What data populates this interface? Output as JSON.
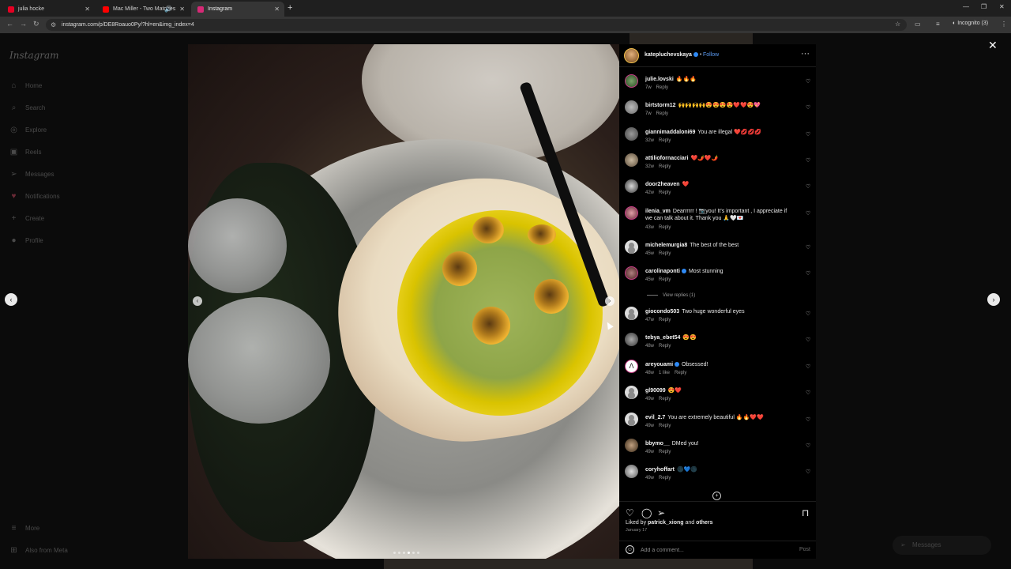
{
  "browser": {
    "tabs": [
      {
        "title": "julia hocke",
        "color": "#e60023"
      },
      {
        "title": "Mac Miller - Two Matches",
        "color": "#ff0000"
      },
      {
        "title": "Instagram",
        "color": "#d62976"
      }
    ],
    "url": "instagram.com/p/DE8Roauo0Py/?hl=en&img_index=4",
    "incognito_label": "Incognito (3)"
  },
  "sidebar": {
    "logo": "Instagram",
    "items": [
      {
        "label": "Home",
        "icon": "home-icon",
        "glyph": "⌂"
      },
      {
        "label": "Search",
        "icon": "search-icon",
        "glyph": "⌕"
      },
      {
        "label": "Explore",
        "icon": "compass-icon",
        "glyph": "◎"
      },
      {
        "label": "Reels",
        "icon": "reels-icon",
        "glyph": "▣"
      },
      {
        "label": "Messages",
        "icon": "send-icon",
        "glyph": "➢"
      },
      {
        "label": "Notifications",
        "icon": "heart-icon",
        "glyph": "♡"
      },
      {
        "label": "Create",
        "icon": "plus-icon",
        "glyph": "+"
      },
      {
        "label": "Profile",
        "icon": "avatar-icon",
        "glyph": "●"
      }
    ],
    "more": "More",
    "also_from_meta": "Also from Meta"
  },
  "post": {
    "username": "katepluchevskaya",
    "follow": "Follow",
    "likes_prefix": "Liked by",
    "liked_by": "patrick_xiong",
    "likes_and": "and",
    "likes_others": "others",
    "date": "January 17",
    "comment_placeholder": "Add a comment...",
    "post_label": "Post",
    "view_replies": "View replies (1)"
  },
  "comments": [
    {
      "user": "julie.lovski",
      "text": "🔥🔥🔥",
      "time": "7w",
      "reply": "Reply",
      "likes": ""
    },
    {
      "user": "birtstorm12",
      "text": "🙌🙌🙌🙌😍😍😍😍❤️❤️😍💖",
      "time": "7w",
      "reply": "Reply",
      "likes": ""
    },
    {
      "user": "giannimaddaloni69",
      "text": "You are illegal ❤️💋💋💋",
      "time": "32w",
      "reply": "Reply",
      "likes": ""
    },
    {
      "user": "attiliofornacciari",
      "text": "❤️🌶️❤️🌶️",
      "time": "32w",
      "reply": "Reply",
      "likes": ""
    },
    {
      "user": "door2heaven",
      "text": "❤️",
      "time": "42w",
      "reply": "Reply",
      "likes": ""
    },
    {
      "user": "ilenia_vm",
      "text": "Dearrrrrr ! 📷you! It's important , I appreciate if we can talk about it. Thank you 🙏🤍💌",
      "time": "43w",
      "reply": "Reply",
      "likes": ""
    },
    {
      "user": "michelemurgia8",
      "text": "The best of the best",
      "time": "45w",
      "reply": "Reply",
      "likes": ""
    },
    {
      "user": "carolinaponti",
      "text": "Most stunning",
      "time": "45w",
      "reply": "Reply",
      "likes": ""
    },
    {
      "user": "giocondo503",
      "text": "Two huge wonderful eyes",
      "time": "47w",
      "reply": "Reply",
      "likes": ""
    },
    {
      "user": "tebya_ebet54",
      "text": "😍😍",
      "time": "48w",
      "reply": "Reply",
      "likes": ""
    },
    {
      "user": "areyouami",
      "text": "Obsessed!",
      "time": "48w",
      "reply": "Reply",
      "likes": "1 like"
    },
    {
      "user": "gl90099",
      "text": "😍❤️",
      "time": "49w",
      "reply": "Reply",
      "likes": ""
    },
    {
      "user": "evil_2.7",
      "text": "You are extremely beautiful 🔥🔥❤️❤️",
      "time": "49w",
      "reply": "Reply",
      "likes": ""
    },
    {
      "user": "bbymo__",
      "text": "DMed you!",
      "time": "49w",
      "reply": "Reply",
      "likes": ""
    },
    {
      "user": "coryhoffart",
      "text": "🌑💙🌑",
      "time": "49w",
      "reply": "Reply",
      "likes": ""
    }
  ],
  "floating": {
    "messages_label": "Messages"
  }
}
